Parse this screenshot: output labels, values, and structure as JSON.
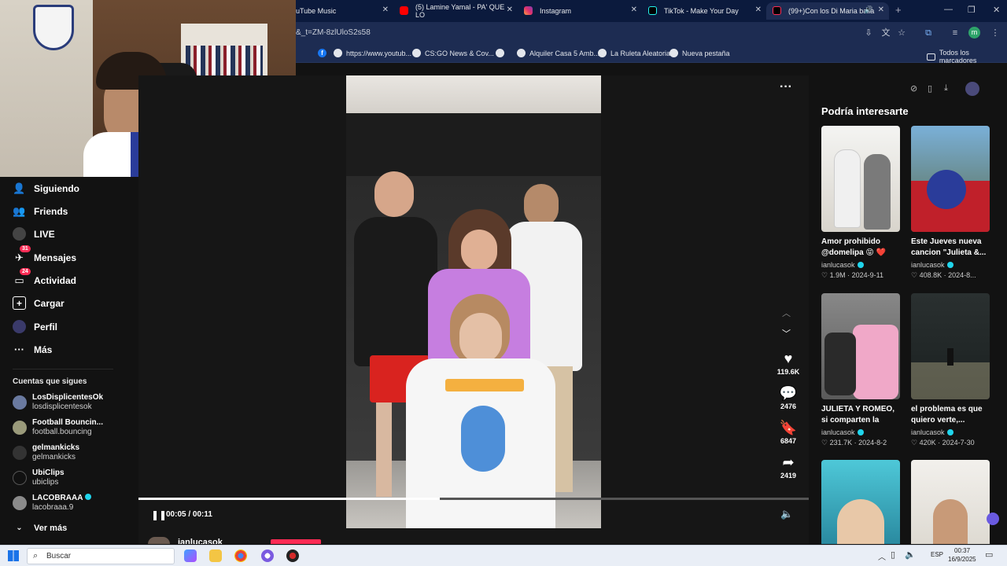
{
  "browser": {
    "tabs": [
      {
        "label": "uTube Music",
        "active": false
      },
      {
        "label": "(5) Lamine Yamal - PA' QUE LO",
        "active": false
      },
      {
        "label": "Instagram",
        "active": false
      },
      {
        "label": "TikTok - Make Your Day",
        "active": false
      },
      {
        "label": "(99+)Con los Di Maria baila",
        "active": true
      }
    ],
    "url": "&_t=ZM-8zlUloS2s58",
    "profile_initial": "m",
    "bookmarks": [
      "https://www.youtub...",
      "CS:GO News & Cov...",
      "Alquiler Casa 5 Amb...",
      "La Ruleta Aleatoria",
      "Nueva pestaña"
    ],
    "all_bookmarks": "Todos los marcadores"
  },
  "sidebar": {
    "nav": [
      {
        "label": "Siguiendo",
        "icon": "following-icon"
      },
      {
        "label": "Friends",
        "icon": "friends-icon"
      },
      {
        "label": "LIVE",
        "icon": "live-icon"
      },
      {
        "label": "Mensajes",
        "icon": "messages-icon",
        "badge": "31"
      },
      {
        "label": "Actividad",
        "icon": "activity-icon",
        "badge": "24"
      },
      {
        "label": "Cargar",
        "icon": "upload-icon"
      },
      {
        "label": "Perfil",
        "icon": "profile-icon"
      },
      {
        "label": "Más",
        "icon": "more-icon"
      }
    ],
    "following_header": "Cuentas que sigues",
    "accounts": [
      {
        "name": "LosDisplicentesOk",
        "handle": "losdisplicentesok"
      },
      {
        "name": "Football Bouncin...",
        "handle": "football.bouncing"
      },
      {
        "name": "gelmankicks",
        "handle": "gelmankicks"
      },
      {
        "name": "UbiClips",
        "handle": "ubiclips"
      },
      {
        "name": "LACOBRAAA",
        "handle": "lacobraaa.9"
      }
    ],
    "see_more": "Ver más"
  },
  "player": {
    "time": "00:05 / 00:11",
    "progress": 0.45,
    "author": "ianlucasok",
    "likes": "119.6K",
    "comments": "2476",
    "saves": "6847",
    "shares": "2419"
  },
  "recommend": {
    "header": "Podría interesarte",
    "cards": [
      {
        "title": "Amor prohibido @domelipa 😝 ❤️",
        "user": "ianlucasok",
        "likes": "1.9M",
        "date": "2024-9-11"
      },
      {
        "title": "Este Jueves nueva cancion \"Julieta &...",
        "user": "ianlucasok",
        "likes": "408.8K",
        "date": "2024-8..."
      },
      {
        "title": "JULIETA Y ROMEO, si comparten la sacol...",
        "user": "ianlucasok",
        "likes": "231.7K",
        "date": "2024-8-2"
      },
      {
        "title": "el problema es que quiero verte,...",
        "user": "ianlucasok",
        "likes": "420K",
        "date": "2024-7-30"
      },
      {
        "title": "",
        "user": "",
        "likes": "",
        "date": ""
      },
      {
        "title": "",
        "user": "",
        "likes": "",
        "date": ""
      }
    ]
  },
  "taskbar": {
    "search_placeholder": "Buscar",
    "lang": "ESP",
    "time": "00:37",
    "date": "16/9/2025"
  },
  "colors": {
    "accent": "#fe2c55",
    "bg": "#121212",
    "chrome": "#1d2c52"
  }
}
